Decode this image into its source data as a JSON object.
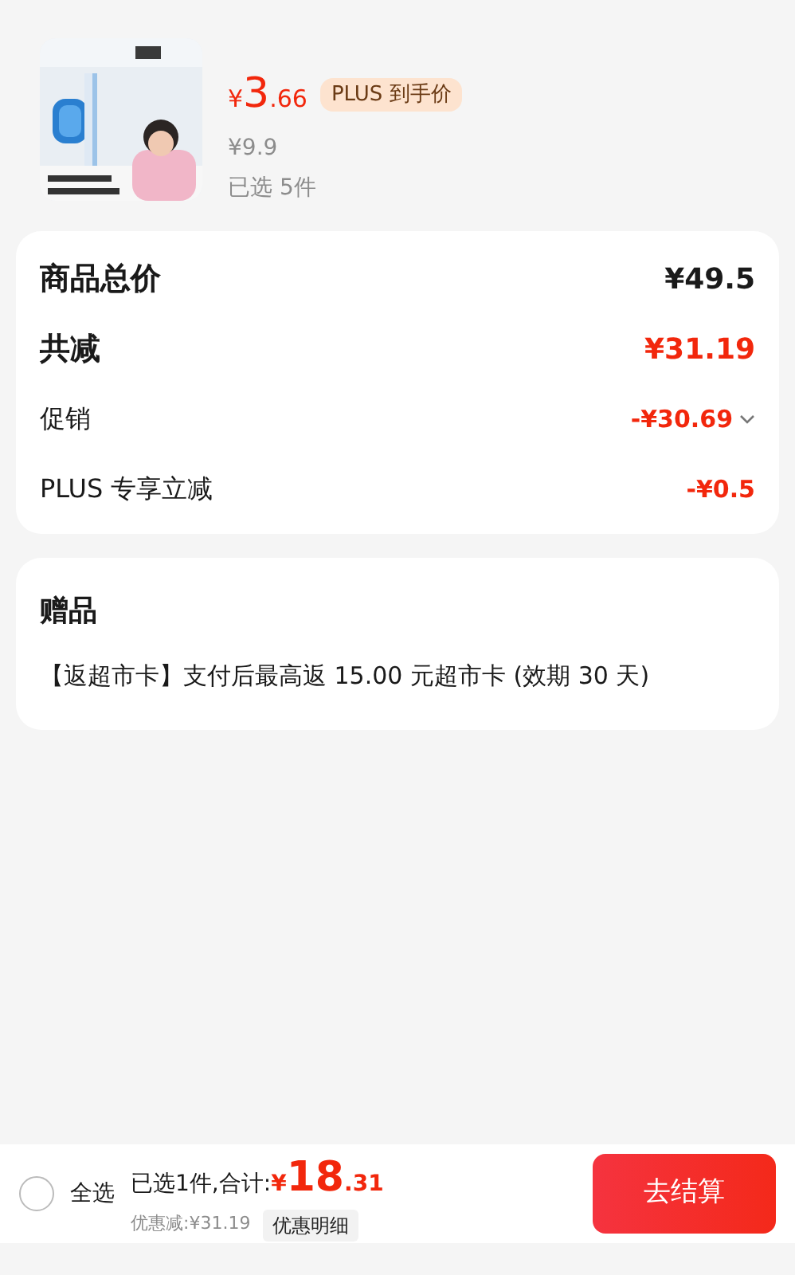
{
  "product": {
    "kind": "picture",
    "price": {
      "symbol": "¥",
      "integer": "3",
      "decimal": ".66"
    },
    "price_badge": "PLUS 到手价",
    "original_price": "¥9.9",
    "selected_count": "已选 5件"
  },
  "summary": [
    {
      "kind": "total",
      "label": "商品总价",
      "value": "¥49.5",
      "expandable": false
    },
    {
      "kind": "discount_total",
      "label": "共减",
      "value": "¥31.19",
      "expandable": false
    },
    {
      "kind": "discount",
      "label": "促销",
      "value": "-¥30.69",
      "expandable": true
    },
    {
      "kind": "discount",
      "label": "PLUS 专享立减",
      "value": "-¥0.5",
      "expandable": false
    }
  ],
  "gifts": {
    "title": "赠品",
    "text": "【返超市卡】支付后最高返 15.00 元超市卡 (效期 30 天)"
  },
  "bottom_bar": {
    "select_all": {
      "label": "全选",
      "checked": false
    },
    "summary_label": "已选1件,合计:",
    "total": {
      "symbol": "¥",
      "integer": "18",
      "decimal": ".31"
    },
    "savings": "优惠减:¥31.19",
    "details_button": "优惠明细",
    "checkout_button": "去结算"
  }
}
